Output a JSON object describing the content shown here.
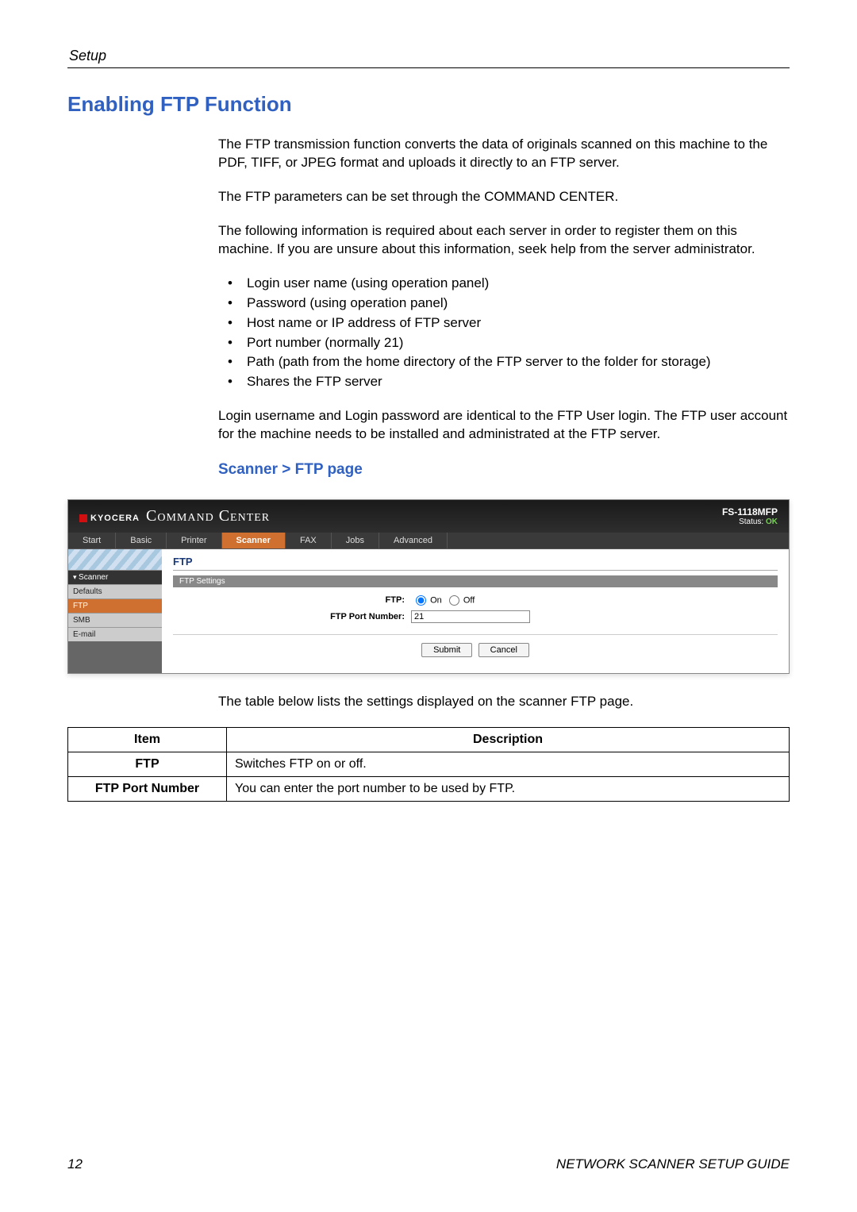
{
  "section_label": "Setup",
  "heading": "Enabling FTP Function",
  "paragraphs": {
    "p1": "The FTP transmission function converts the data of originals scanned on this machine to the PDF, TIFF, or JPEG format and uploads it directly to an FTP server.",
    "p2": "The FTP parameters can be set through the COMMAND CENTER.",
    "p3": "The following information is required about each server in order to register them on this machine. If you are unsure about this information, seek help from the server administrator.",
    "p4": "Login username and Login password are identical to the FTP User login. The FTP user account for the machine needs to be installed and administrated at the FTP server."
  },
  "bullets": [
    "Login user name (using operation panel)",
    "Password (using operation panel)",
    "Host name or IP address of FTP server",
    "Port number (normally 21)",
    "Path (path from the home directory of the FTP server to the folder for storage)",
    "Shares the FTP server"
  ],
  "subheading": "Scanner > FTP page",
  "screenshot": {
    "logo_text": "KYOCERA",
    "app_title": "Command Center",
    "model": "FS-1118MFP",
    "status_label": "Status:",
    "status_value": "OK",
    "tabs": [
      "Start",
      "Basic",
      "Printer",
      "Scanner",
      "FAX",
      "Jobs",
      "Advanced"
    ],
    "active_tab_index": 3,
    "side_group": "Scanner",
    "side_items": [
      "Defaults",
      "FTP",
      "SMB",
      "E-mail"
    ],
    "side_active_index": 1,
    "panel_title": "FTP",
    "panel_subtitle": "FTP Settings",
    "field_ftp_label": "FTP:",
    "radio_on": "On",
    "radio_off": "Off",
    "field_port_label": "FTP Port Number:",
    "field_port_value": "21",
    "submit_label": "Submit",
    "cancel_label": "Cancel"
  },
  "table_intro": "The table below lists the settings displayed on the scanner FTP page.",
  "table": {
    "head_item": "Item",
    "head_desc": "Description",
    "rows": [
      {
        "item": "FTP",
        "desc": "Switches FTP on or off."
      },
      {
        "item": "FTP Port Number",
        "desc": "You can enter the port number to be used by FTP."
      }
    ]
  },
  "footer": {
    "page_number": "12",
    "doc_title": "NETWORK SCANNER SETUP GUIDE"
  }
}
